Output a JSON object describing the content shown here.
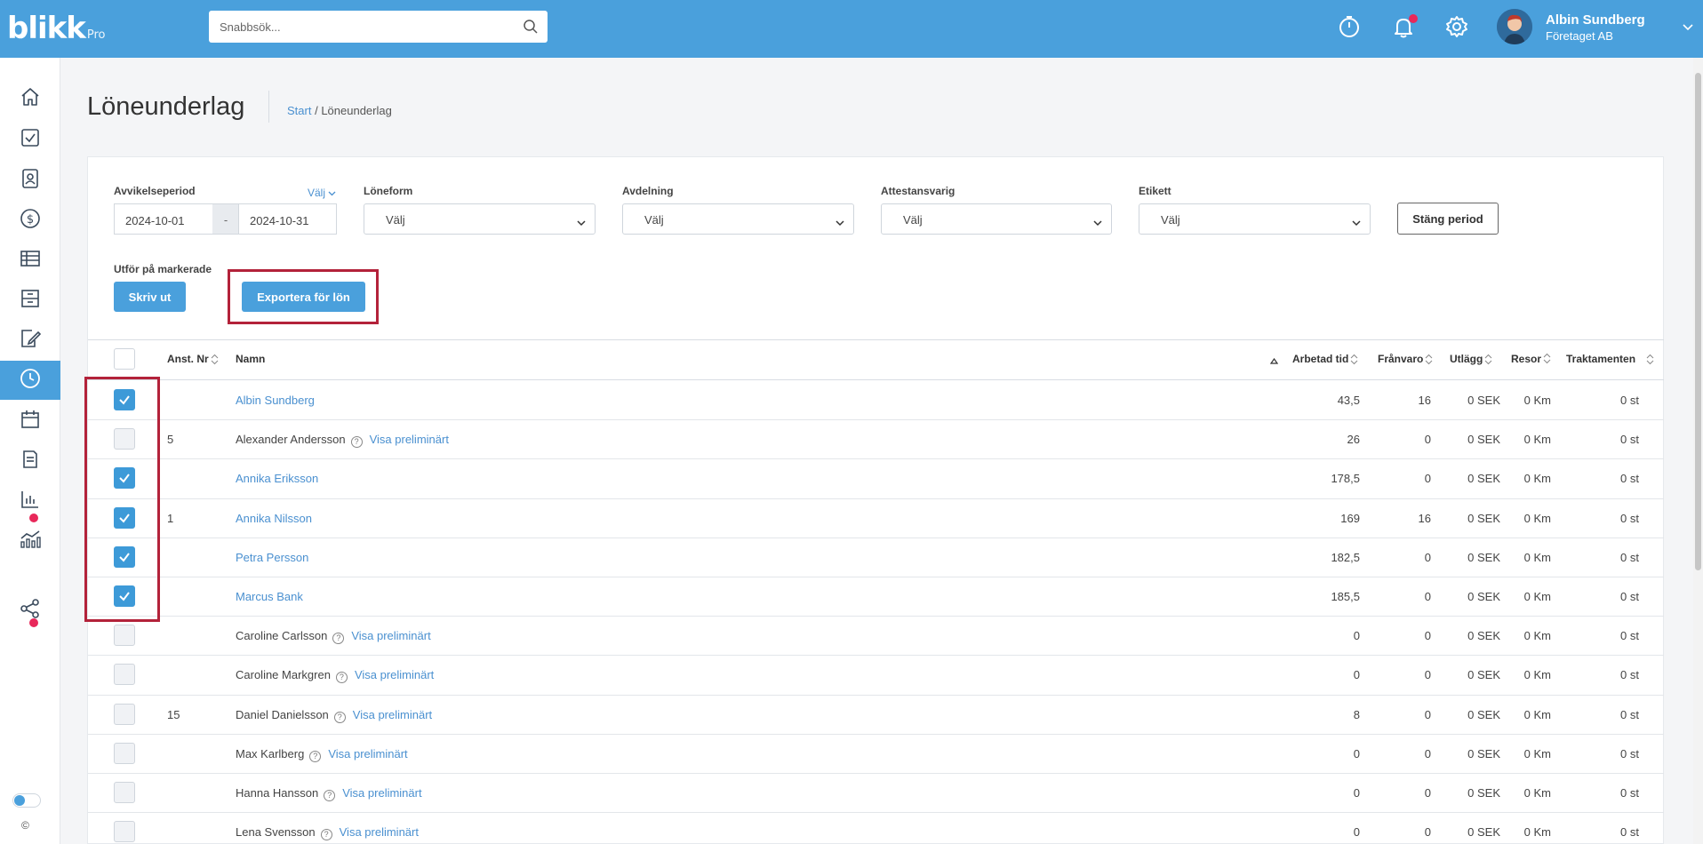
{
  "app": {
    "logo": "blikk",
    "logo_suffix": "Pro"
  },
  "search": {
    "placeholder": "Snabbsök..."
  },
  "user": {
    "name": "Albin Sundberg",
    "company": "Företaget AB"
  },
  "page": {
    "title": "Löneunderlag",
    "breadcrumb_home": "Start",
    "breadcrumb_sep": " / ",
    "breadcrumb_current": "Löneunderlag"
  },
  "filters": {
    "period_label": "Avvikelseperiod",
    "period_pick": "Välj",
    "date_from": "2024-10-01",
    "date_sep": "-",
    "date_to": "2024-10-31",
    "loneform_label": "Löneform",
    "loneform_value": "Välj",
    "avdelning_label": "Avdelning",
    "avdelning_value": "Välj",
    "attest_label": "Attestansvarig",
    "attest_value": "Välj",
    "etikett_label": "Etikett",
    "etikett_value": "Välj",
    "close_period": "Stäng period"
  },
  "actions": {
    "label": "Utför på markerade",
    "print": "Skriv ut",
    "export": "Exportera för lön"
  },
  "table": {
    "columns": {
      "anst_nr": "Anst. Nr",
      "namn": "Namn",
      "arbetad_tid": "Arbetad tid",
      "franvaro": "Frånvaro",
      "utlagg": "Utlägg",
      "resor": "Resor",
      "traktamenten": "Traktamenten"
    },
    "prelim_label": "Visa preliminärt",
    "rows": [
      {
        "checked": true,
        "nr": "",
        "name": "Albin Sundberg",
        "link": true,
        "prelim": false,
        "tid": "43,5",
        "franvaro": "16",
        "utlagg": "0 SEK",
        "resor": "0 Km",
        "trakt": "0 st"
      },
      {
        "checked": false,
        "nr": "5",
        "name": "Alexander Andersson",
        "link": false,
        "prelim": true,
        "tid": "26",
        "franvaro": "0",
        "utlagg": "0 SEK",
        "resor": "0 Km",
        "trakt": "0 st"
      },
      {
        "checked": true,
        "nr": "",
        "name": "Annika Eriksson",
        "link": true,
        "prelim": false,
        "tid": "178,5",
        "franvaro": "0",
        "utlagg": "0 SEK",
        "resor": "0 Km",
        "trakt": "0 st"
      },
      {
        "checked": true,
        "nr": "1",
        "name": "Annika Nilsson",
        "link": true,
        "prelim": false,
        "tid": "169",
        "franvaro": "16",
        "utlagg": "0 SEK",
        "resor": "0 Km",
        "trakt": "0 st"
      },
      {
        "checked": true,
        "nr": "",
        "name": "Petra Persson",
        "link": true,
        "prelim": false,
        "tid": "182,5",
        "franvaro": "0",
        "utlagg": "0 SEK",
        "resor": "0 Km",
        "trakt": "0 st"
      },
      {
        "checked": true,
        "nr": "",
        "name": "Marcus Bank",
        "link": true,
        "prelim": false,
        "tid": "185,5",
        "franvaro": "0",
        "utlagg": "0 SEK",
        "resor": "0 Km",
        "trakt": "0 st"
      },
      {
        "checked": false,
        "nr": "",
        "name": "Caroline Carlsson",
        "link": false,
        "prelim": true,
        "tid": "0",
        "franvaro": "0",
        "utlagg": "0 SEK",
        "resor": "0 Km",
        "trakt": "0 st"
      },
      {
        "checked": false,
        "nr": "",
        "name": "Caroline Markgren",
        "link": false,
        "prelim": true,
        "tid": "0",
        "franvaro": "0",
        "utlagg": "0 SEK",
        "resor": "0 Km",
        "trakt": "0 st"
      },
      {
        "checked": false,
        "nr": "15",
        "name": "Daniel Danielsson",
        "link": false,
        "prelim": true,
        "tid": "8",
        "franvaro": "0",
        "utlagg": "0 SEK",
        "resor": "0 Km",
        "trakt": "0 st"
      },
      {
        "checked": false,
        "nr": "",
        "name": "Max Karlberg",
        "link": false,
        "prelim": true,
        "tid": "0",
        "franvaro": "0",
        "utlagg": "0 SEK",
        "resor": "0 Km",
        "trakt": "0 st"
      },
      {
        "checked": false,
        "nr": "",
        "name": "Hanna Hansson",
        "link": false,
        "prelim": true,
        "tid": "0",
        "franvaro": "0",
        "utlagg": "0 SEK",
        "resor": "0 Km",
        "trakt": "0 st"
      },
      {
        "checked": false,
        "nr": "",
        "name": "Lena Svensson",
        "link": false,
        "prelim": true,
        "tid": "0",
        "franvaro": "0",
        "utlagg": "0 SEK",
        "resor": "0 Km",
        "trakt": "0 st"
      }
    ]
  },
  "sidebar": {
    "items": [
      {
        "icon": "home-icon"
      },
      {
        "icon": "checkbox-icon"
      },
      {
        "icon": "contacts-icon"
      },
      {
        "icon": "dollar-icon"
      },
      {
        "icon": "table-icon"
      },
      {
        "icon": "archive-icon"
      },
      {
        "icon": "edit-document-icon"
      },
      {
        "icon": "clock-icon",
        "active": true
      },
      {
        "icon": "calendar-icon"
      },
      {
        "icon": "invoice-icon",
        "badge": true
      },
      {
        "icon": "bar-chart-icon"
      },
      {
        "icon": "analytics-icon"
      },
      {
        "icon": "share-icon",
        "badge": true
      }
    ],
    "footer_copy": "©"
  },
  "colors": {
    "topbar": "#4aa0dc",
    "accent": "#4aa0dc",
    "link": "#4a90d0",
    "badge": "#e8285a",
    "highlight": "#b3223a"
  }
}
